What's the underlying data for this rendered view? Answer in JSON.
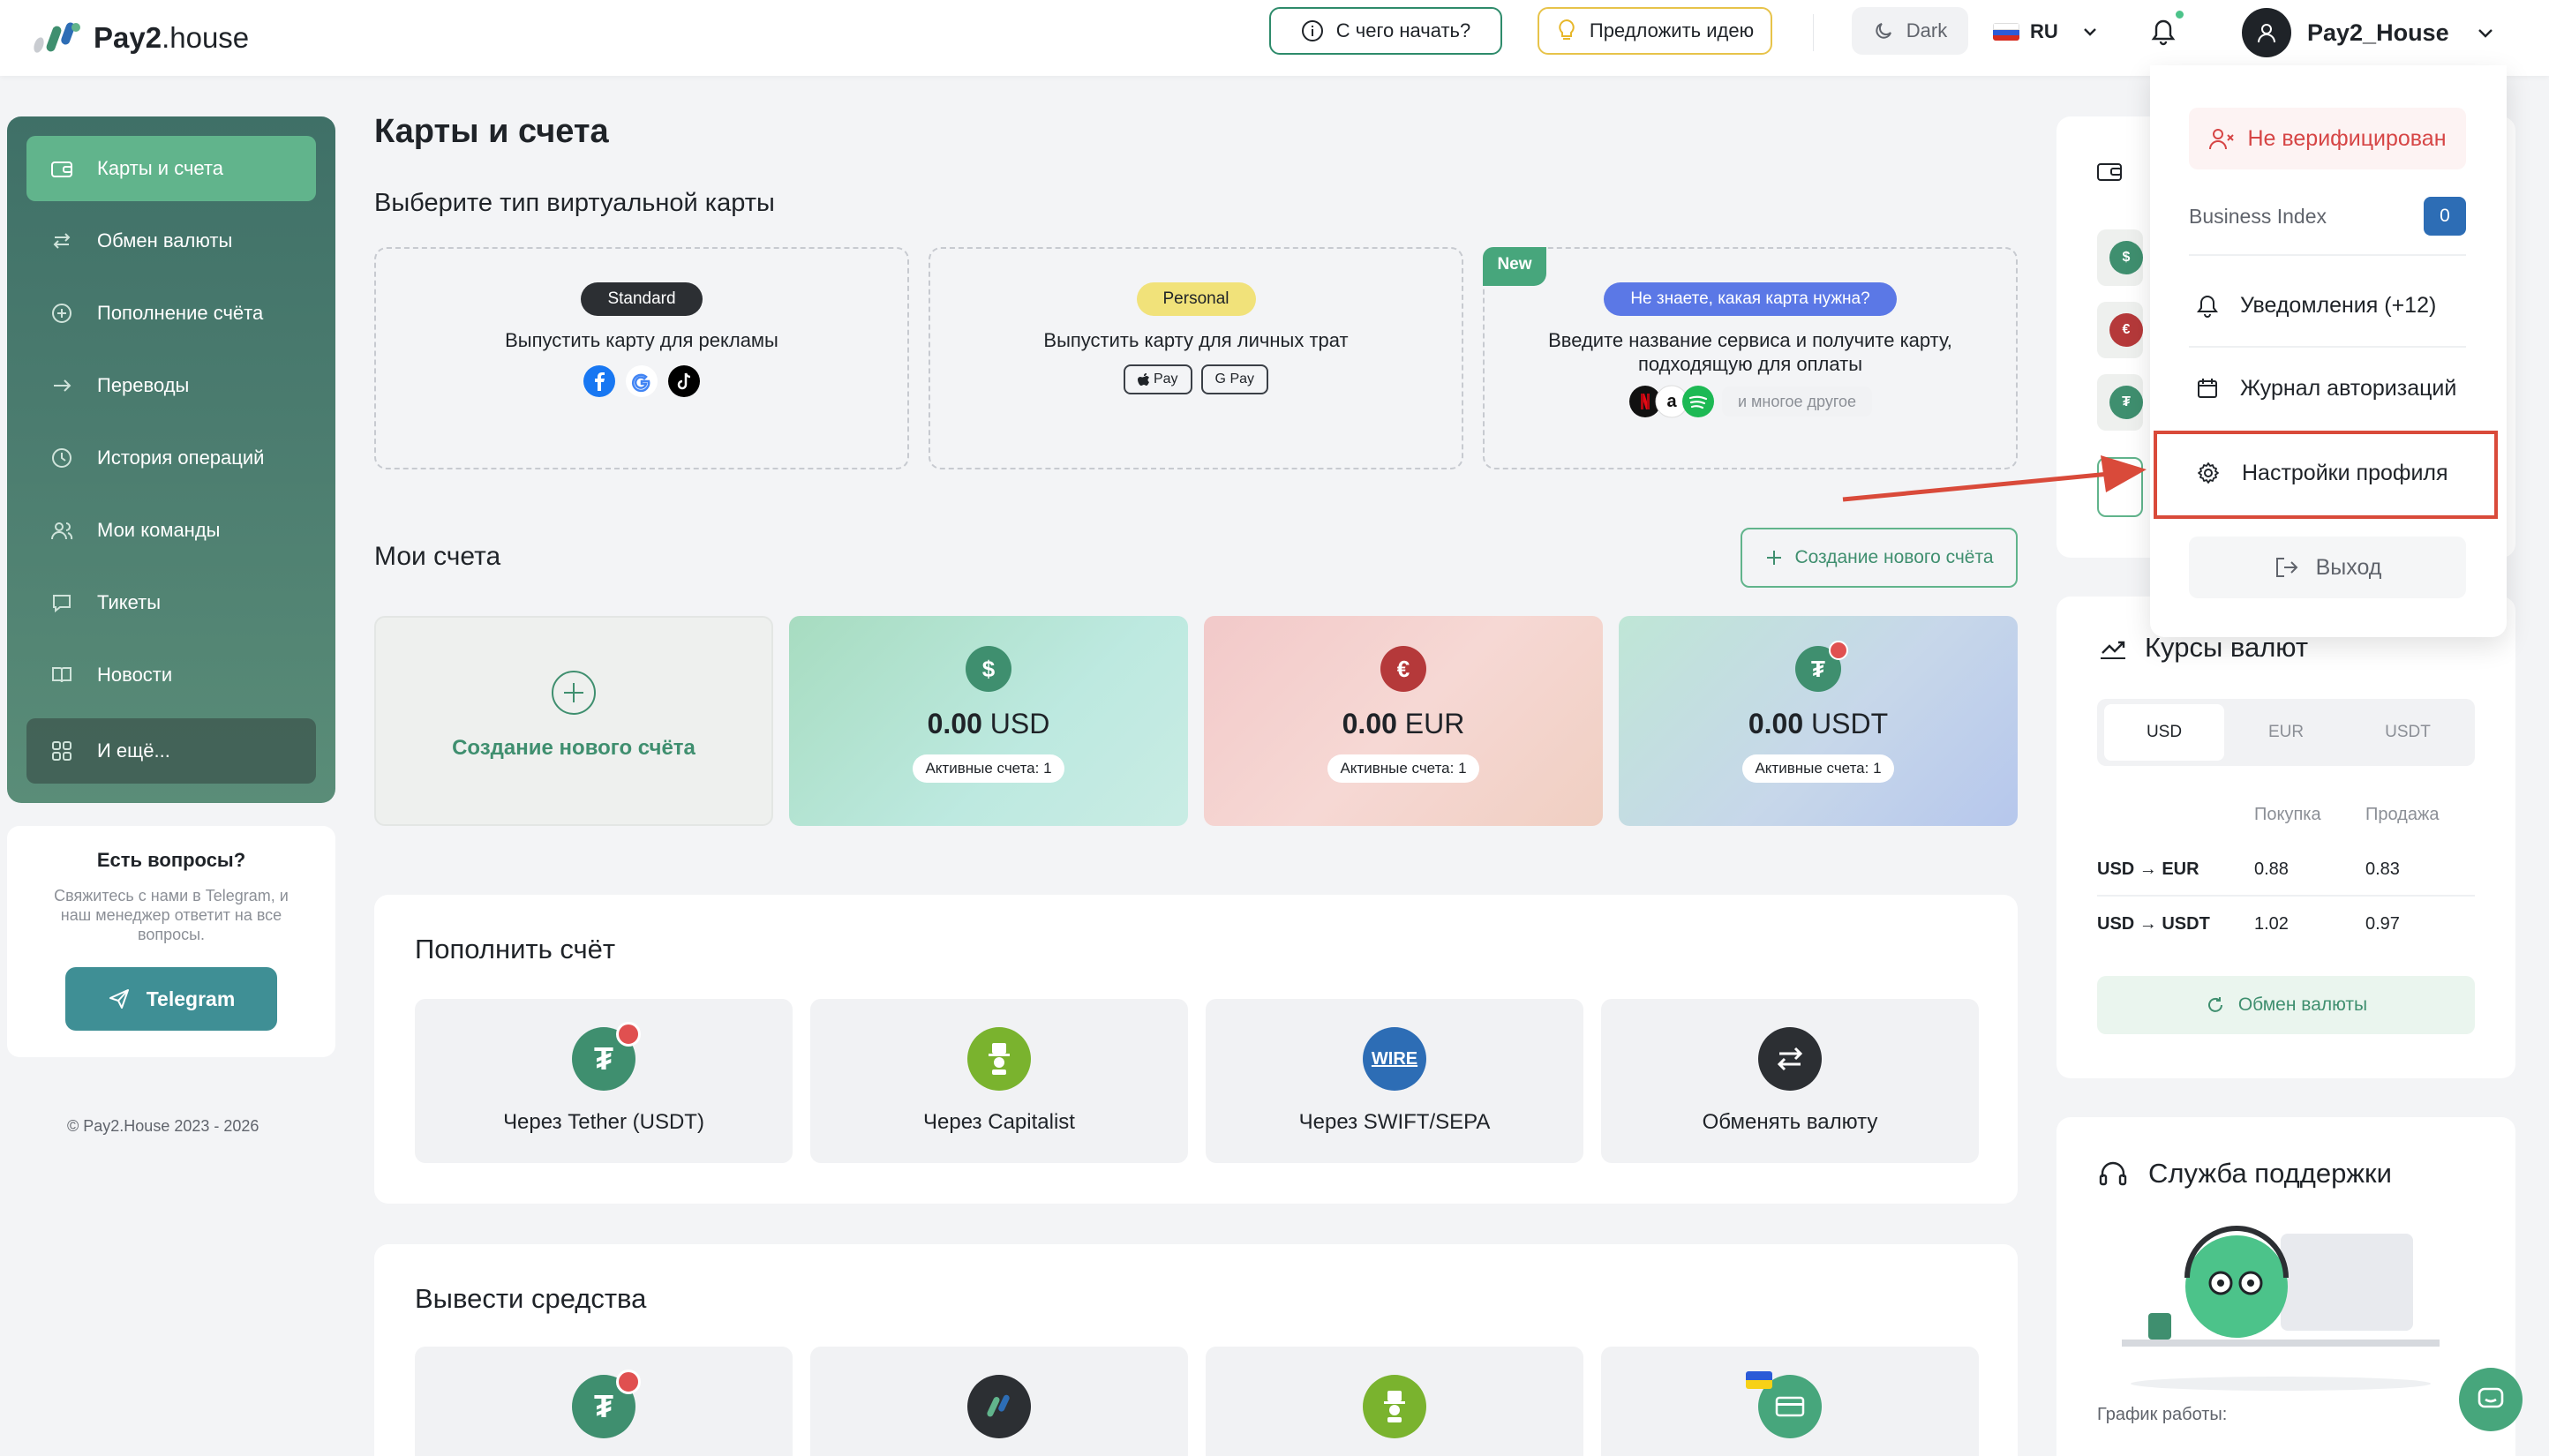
{
  "app": {
    "brand_bold": "Pay2",
    "brand_rest": ".house"
  },
  "header": {
    "start_label": "С чего начать?",
    "idea_label": "Предложить идею",
    "theme_label": "Dark",
    "lang_label": "RU",
    "user_name": "Pay2_House"
  },
  "sidebar": {
    "items": [
      {
        "label": "Карты и счета",
        "icon": "wallet-icon"
      },
      {
        "label": "Обмен валюты",
        "icon": "exchange-icon"
      },
      {
        "label": "Пополнение счёта",
        "icon": "plus-circle-icon"
      },
      {
        "label": "Переводы",
        "icon": "arrow-right-icon"
      },
      {
        "label": "История операций",
        "icon": "clock-icon"
      },
      {
        "label": "Мои команды",
        "icon": "users-icon"
      },
      {
        "label": "Тикеты",
        "icon": "chat-icon"
      },
      {
        "label": "Новости",
        "icon": "book-icon"
      },
      {
        "label": "И ещё...",
        "icon": "grid-icon"
      }
    ],
    "help": {
      "title": "Есть вопросы?",
      "text": "Свяжитесь с нами в Telegram, и наш менеджер ответит на все вопросы.",
      "button": "Telegram"
    },
    "copyright": "© Pay2.House 2023 - 2026"
  },
  "main": {
    "title": "Карты и счета",
    "virtual_title": "Выберите тип виртуальной карты",
    "cards": [
      {
        "badge": "Standard",
        "text": "Выпустить карту для рекламы"
      },
      {
        "badge": "Personal",
        "text": "Выпустить карту для личных трат",
        "pay1": "Pay",
        "pay2": "G Pay"
      },
      {
        "tag": "New",
        "badge": "Не знаете, какая карта нужна?",
        "text": "Введите название сервиса и получите карту, подходящую для оплаты",
        "more": "и многое другое"
      }
    ],
    "accounts_title": "Мои счета",
    "new_account_btn": "Создание нового счёта",
    "new_account_tile": "Создание нового счёта",
    "accounts": [
      {
        "amount": "0.00",
        "currency": "USD",
        "active": "Активные счета: 1"
      },
      {
        "amount": "0.00",
        "currency": "EUR",
        "active": "Активные счета: 1"
      },
      {
        "amount": "0.00",
        "currency": "USDT",
        "active": "Активные счета: 1"
      }
    ],
    "topup": {
      "title": "Пополнить счёт",
      "items": [
        "Через Tether (USDT)",
        "Через Capitalist",
        "Через SWIFT/SEPA",
        "Обменять валюту"
      ],
      "wire_text": "WIRE"
    },
    "withdraw": {
      "title": "Вывести средства"
    }
  },
  "rates": {
    "title": "Курсы валют",
    "tabs": [
      "USD",
      "EUR",
      "USDT"
    ],
    "col_buy": "Покупка",
    "col_sell": "Продажа",
    "rows": [
      {
        "pair": "USD → EUR",
        "buy": "0.88",
        "sell": "0.83"
      },
      {
        "pair": "USD → USDT",
        "buy": "1.02",
        "sell": "0.97"
      }
    ],
    "exchange_btn": "Обмен валюты"
  },
  "support": {
    "title": "Служба поддержки",
    "schedule": "График работы:"
  },
  "dropdown": {
    "unverified": "Не верифицирован",
    "business_index_label": "Business Index",
    "business_index_value": "0",
    "notifications": "Уведомления (+12)",
    "auth_log": "Журнал авторизаций",
    "settings": "Настройки профиля",
    "logout": "Выход"
  },
  "colors": {
    "accent": "#61b48c",
    "highlight": "#d94a3a",
    "brand_dark": "#1f2328"
  }
}
